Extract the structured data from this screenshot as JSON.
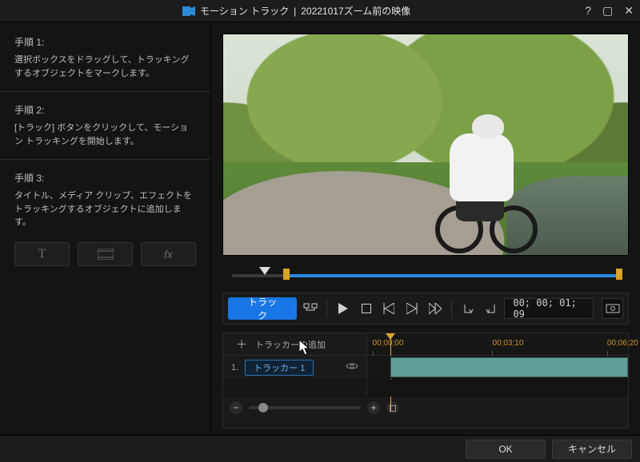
{
  "window": {
    "title_left": "モーション トラック",
    "title_sep": " | ",
    "title_right": "20221017ズーム前の映像"
  },
  "steps": {
    "s1_title": "手順 1:",
    "s1_body": "選択ボックスをドラッグして、トラッキングするオブジェクトをマークします。",
    "s2_title": "手順 2:",
    "s2_body": "[トラック] ボタンをクリックして、モーション トラッキングを開始します。",
    "s3_title": "手順 3:",
    "s3_body": "タイトル、メディア クリップ、エフェクトをトラッキングするオブジェクトに追加します。"
  },
  "toolbar": {
    "track_label": "トラック"
  },
  "timecode": "00; 00; 01; 09",
  "timeline": {
    "add_tracker": "トラッカーの追加",
    "ticks": [
      "00;00;00",
      "00;03;10",
      "00;06;20"
    ],
    "tick_positions_pct": [
      2,
      48,
      92
    ],
    "playhead_pct": 9,
    "tracks": [
      {
        "index": "1.",
        "name": "トラッカー 1",
        "clip_left_pct": 9,
        "clip_right_pct": 100
      }
    ]
  },
  "footer": {
    "ok": "OK",
    "cancel": "キャンセル"
  },
  "colors": {
    "accent": "#1976e6",
    "range": "#d9a32c",
    "track_progress": "#2b8ae0",
    "clip": "#5f9e97"
  }
}
